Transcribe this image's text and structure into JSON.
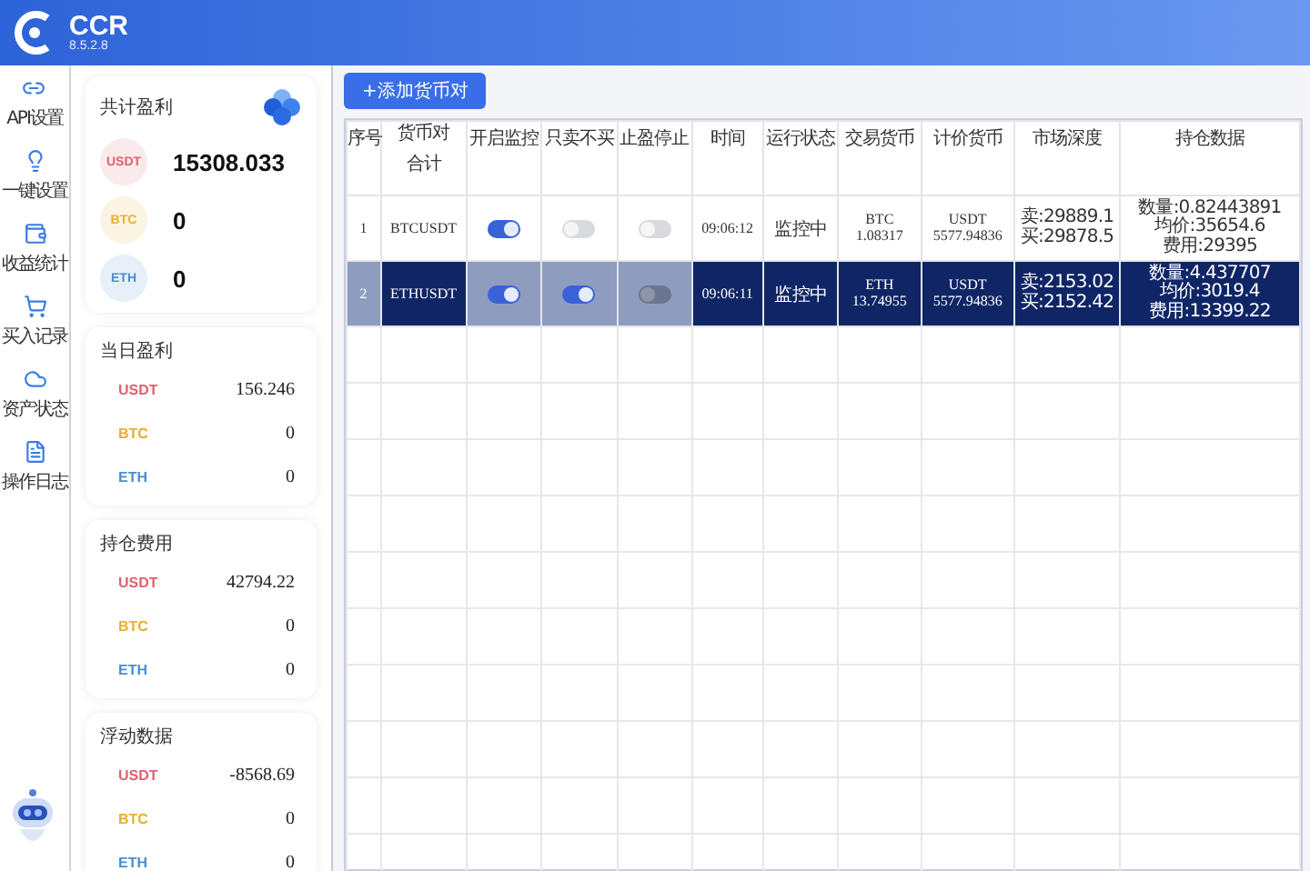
{
  "app": {
    "name": "CCR",
    "version": "8.5.2.8"
  },
  "sidebar": {
    "items": [
      {
        "label": "API设置"
      },
      {
        "label": "一键设置"
      },
      {
        "label": "收益统计"
      },
      {
        "label": "买入记录"
      },
      {
        "label": "资产状态"
      },
      {
        "label": "操作日志"
      }
    ]
  },
  "summary": {
    "title": "共计盈利",
    "coins": [
      {
        "symbol": "USDT",
        "value": "15308.033",
        "color": "#e0606e"
      },
      {
        "symbol": "BTC",
        "value": "0",
        "color": "#e8b030"
      },
      {
        "symbol": "ETH",
        "value": "0",
        "color": "#4a8fd0"
      }
    ]
  },
  "stat_cards": [
    {
      "title": "当日盈利",
      "rows": [
        {
          "symbol": "USDT",
          "value": "156.246",
          "color": "#e0606e"
        },
        {
          "symbol": "BTC",
          "value": "0",
          "color": "#e8b030"
        },
        {
          "symbol": "ETH",
          "value": "0",
          "color": "#4a8fd0"
        }
      ]
    },
    {
      "title": "持仓费用",
      "rows": [
        {
          "symbol": "USDT",
          "value": "42794.22",
          "color": "#e0606e"
        },
        {
          "symbol": "BTC",
          "value": "0",
          "color": "#e8b030"
        },
        {
          "symbol": "ETH",
          "value": "0",
          "color": "#4a8fd0"
        }
      ]
    },
    {
      "title": "浮动数据",
      "rows": [
        {
          "symbol": "USDT",
          "value": "-8568.69",
          "color": "#e0606e"
        },
        {
          "symbol": "BTC",
          "value": "0",
          "color": "#e8b030"
        },
        {
          "symbol": "ETH",
          "value": "0",
          "color": "#4a8fd0"
        }
      ]
    }
  ],
  "add_button": "+添加货币对",
  "table": {
    "columns": [
      "序号",
      "货币对",
      "开启监控",
      "只卖不买",
      "止盈停止",
      "时间",
      "运行状态",
      "交易货币",
      "计价货币",
      "市场深度",
      "持仓数据"
    ],
    "total_label": "合计",
    "rows": [
      {
        "index": "1",
        "pair": "BTCUSDT",
        "monitor": true,
        "sell_only": false,
        "take_profit_stop": false,
        "time": "09:06:12",
        "status": "监控中",
        "trade_currency": [
          "BTC",
          "1.08317"
        ],
        "quote_currency": [
          "USDT",
          "5577.94836"
        ],
        "depth": [
          "卖:29889.1",
          "买:29878.5"
        ],
        "holdings": [
          "数量:0.82443891",
          "均价:35654.6",
          "费用:29395"
        ],
        "selected": false
      },
      {
        "index": "2",
        "pair": "ETHUSDT",
        "monitor": true,
        "sell_only": true,
        "take_profit_stop": false,
        "time": "09:06:11",
        "status": "监控中",
        "trade_currency": [
          "ETH",
          "13.74955"
        ],
        "quote_currency": [
          "USDT",
          "5577.94836"
        ],
        "depth": [
          "卖:2153.02",
          "买:2152.42"
        ],
        "holdings": [
          "数量:4.437707",
          "均价:3019.4",
          "费用:13399.22"
        ],
        "selected": true
      }
    ]
  }
}
